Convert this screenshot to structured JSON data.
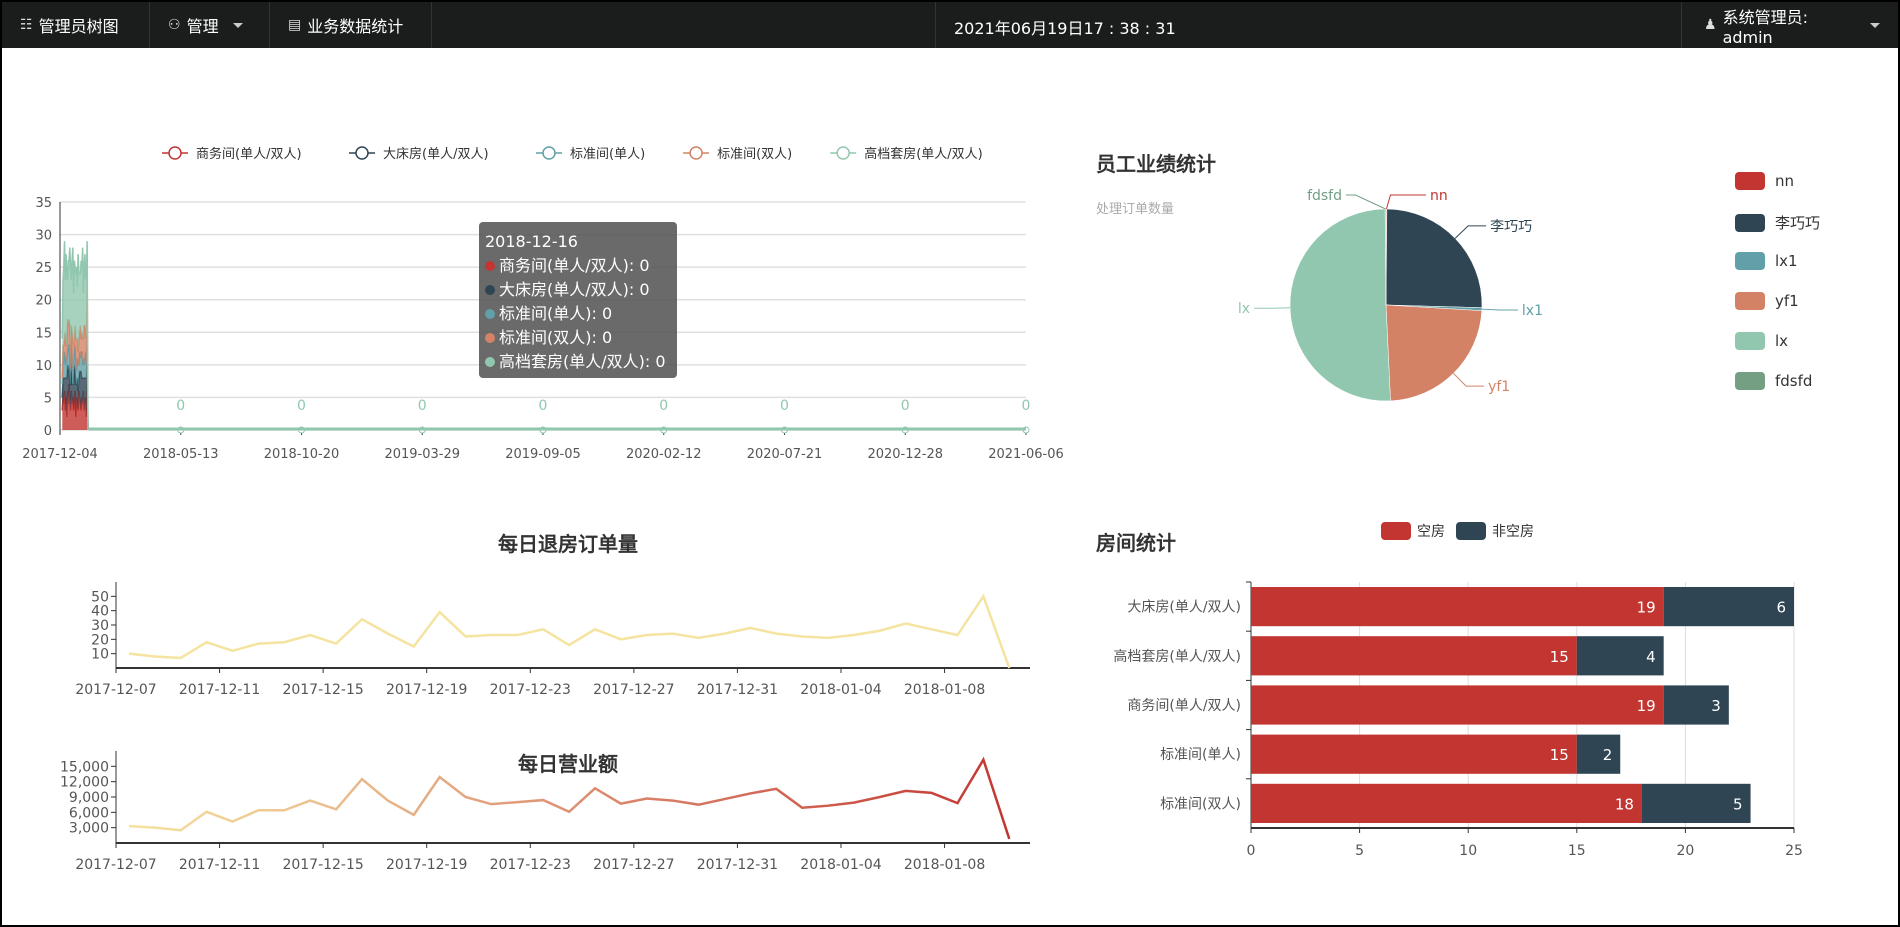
{
  "nav": {
    "tree": "管理员树图",
    "manage": "管理",
    "stats": "业务数据统计",
    "datetime": "2021年06月19日17 : 38 : 31",
    "user": "系统管理员: admin"
  },
  "colors": {
    "red": "#c23531",
    "dark": "#2f4554",
    "teal": "#61a0a8",
    "orange": "#d48265",
    "green": "#91c7ae",
    "fdsfd": "#749f83",
    "yellow": "#f5e3a0"
  },
  "tooltip": {
    "title": "2018-12-16",
    "rows": [
      "商务间(单人/双人): 0",
      "大床房(单人/双人): 0",
      "标准间(单人): 0",
      "标准间(双人): 0",
      "高档套房(单人/双人): 0"
    ]
  },
  "chart_data": [
    {
      "type": "area",
      "stacked": true,
      "legend": [
        "商务间(单人/双人)",
        "大床房(单人/双人)",
        "标准间(单人)",
        "标准间(双人)",
        "高档套房(单人/双人)"
      ],
      "x_ticks": [
        "2017-12-04",
        "2018-05-13",
        "2018-10-20",
        "2019-03-29",
        "2019-09-05",
        "2020-02-12",
        "2020-07-21",
        "2020-12-28",
        "2021-06-06"
      ],
      "y_ticks": [
        0,
        5,
        10,
        15,
        20,
        25,
        30,
        35
      ],
      "ylim": [
        0,
        35
      ],
      "zero_label": "0",
      "dense_start": "2017-12-07",
      "series": [
        {
          "name": "商务间(单人/双人)",
          "values": [
            3,
            5,
            4,
            6,
            3,
            5,
            2,
            6,
            4,
            7,
            5,
            3,
            6,
            4,
            5,
            3,
            4,
            6,
            2,
            5,
            4,
            3,
            6,
            5,
            4,
            3,
            5,
            4,
            6,
            3,
            5,
            4,
            2,
            8,
            0
          ]
        },
        {
          "name": "大床房(单人/双人)",
          "values": [
            2,
            3,
            4,
            2,
            5,
            3,
            6,
            4,
            5,
            3,
            2,
            4,
            5,
            3,
            2,
            4,
            6,
            3,
            5,
            2,
            4,
            3,
            2,
            4,
            5,
            6,
            3,
            4,
            2,
            5,
            3,
            4,
            6,
            4,
            0
          ]
        },
        {
          "name": "标准间(单人)",
          "values": [
            2,
            3,
            2,
            4,
            3,
            2,
            3,
            2,
            4,
            3,
            3,
            2,
            3,
            4,
            2,
            3,
            2,
            4,
            3,
            2,
            3,
            4,
            2,
            3,
            2,
            3,
            4,
            2,
            3,
            2,
            3,
            4,
            2,
            3,
            0
          ]
        },
        {
          "name": "标准间(双人)",
          "values": [
            1,
            2,
            3,
            2,
            4,
            3,
            2,
            5,
            3,
            4,
            6,
            3,
            2,
            4,
            5,
            3,
            2,
            3,
            4,
            5,
            3,
            2,
            4,
            3,
            5,
            2,
            3,
            4,
            3,
            6,
            5,
            3,
            4,
            8,
            0
          ]
        },
        {
          "name": "高档套房(单人/双人)",
          "values": [
            6,
            10,
            12,
            15,
            8,
            14,
            11,
            6,
            10,
            9,
            12,
            13,
            7,
            11,
            14,
            8,
            12,
            9,
            10,
            11,
            8,
            15,
            10,
            9,
            8,
            12,
            10,
            14,
            7,
            9,
            11,
            8,
            10,
            6,
            0
          ]
        }
      ]
    },
    {
      "type": "pie",
      "title": "员工业绩统计",
      "subtitle": "处理订单数量",
      "slices": [
        {
          "name": "nn",
          "value": 0.3
        },
        {
          "name": "李巧巧",
          "value": 51
        },
        {
          "name": "lx1",
          "value": 1
        },
        {
          "name": "yf1",
          "value": 47
        },
        {
          "name": "lx",
          "value": 102
        },
        {
          "name": "fdsfd",
          "value": 0.3
        }
      ]
    },
    {
      "type": "line",
      "title": "每日退房订单量",
      "x_ticks": [
        "2017-12-07",
        "2017-12-11",
        "2017-12-15",
        "2017-12-19",
        "2017-12-23",
        "2017-12-27",
        "2017-12-31",
        "2018-01-04",
        "2018-01-08"
      ],
      "y_ticks": [
        10,
        20,
        30,
        40,
        50
      ],
      "ylim": [
        0,
        60
      ],
      "values": [
        10,
        8,
        7,
        18,
        12,
        17,
        18,
        23,
        17,
        34,
        24,
        15,
        39,
        22,
        23,
        23,
        27,
        16,
        27,
        20,
        23,
        24,
        21,
        24,
        28,
        24,
        22,
        21,
        23,
        26,
        31,
        27,
        23,
        50,
        0
      ]
    },
    {
      "type": "line",
      "title": "每日营业额",
      "x_ticks": [
        "2017-12-07",
        "2017-12-11",
        "2017-12-15",
        "2017-12-19",
        "2017-12-23",
        "2017-12-27",
        "2017-12-31",
        "2018-01-04",
        "2018-01-08"
      ],
      "y_ticks": [
        "3,000",
        "6,000",
        "9,000",
        "12,000",
        "15,000"
      ],
      "ylim": [
        0,
        18000
      ],
      "values": [
        3300,
        3000,
        2500,
        6100,
        4200,
        6400,
        6400,
        8300,
        6600,
        12500,
        8300,
        5500,
        12900,
        9000,
        7600,
        8000,
        8400,
        6100,
        10700,
        7700,
        8700,
        8300,
        7500,
        8600,
        9700,
        10600,
        6900,
        7300,
        7900,
        9000,
        10200,
        9800,
        7800,
        16300,
        800
      ]
    },
    {
      "type": "bar",
      "stacked": true,
      "orientation": "horizontal",
      "title": "房间统计",
      "legend": [
        "空房",
        "非空房"
      ],
      "categories": [
        "大床房(单人/双人)",
        "高档套房(单人/双人)",
        "商务间(单人/双人)",
        "标准间(单人)",
        "标准间(双人)"
      ],
      "series": [
        {
          "name": "空房",
          "values": [
            19,
            15,
            19,
            15,
            18
          ]
        },
        {
          "name": "非空房",
          "values": [
            6,
            4,
            3,
            2,
            5
          ]
        }
      ],
      "x_ticks": [
        0,
        5,
        10,
        15,
        20,
        25
      ],
      "xlim": [
        0,
        25
      ]
    }
  ]
}
